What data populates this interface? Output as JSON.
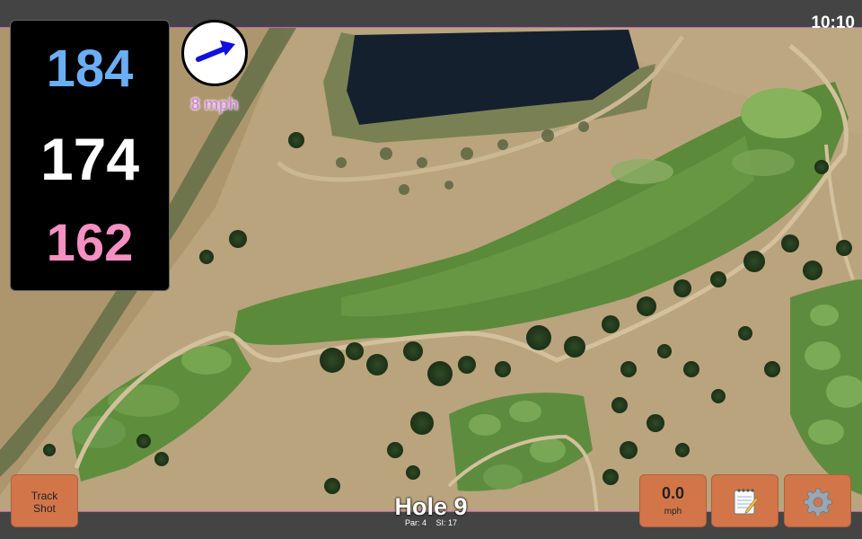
{
  "status": {
    "time": "10:10"
  },
  "distances": {
    "back": "184",
    "middle": "174",
    "front": "162"
  },
  "wind": {
    "speed_label": "8 mph"
  },
  "hole": {
    "title": "Hole 9",
    "par": "Par: 4",
    "si": "SI: 17"
  },
  "buttons": {
    "track_shot": "Track\nShot",
    "speed_value": "0.0",
    "speed_unit": "mph",
    "notes_icon": "notepad-icon",
    "settings_icon": "gear-icon"
  },
  "colors": {
    "back_distance": "#6aaef5",
    "middle_distance": "#ffffff",
    "front_distance": "#f590c2",
    "button": "#d2764a",
    "wind_arrow": "#1010e0"
  }
}
